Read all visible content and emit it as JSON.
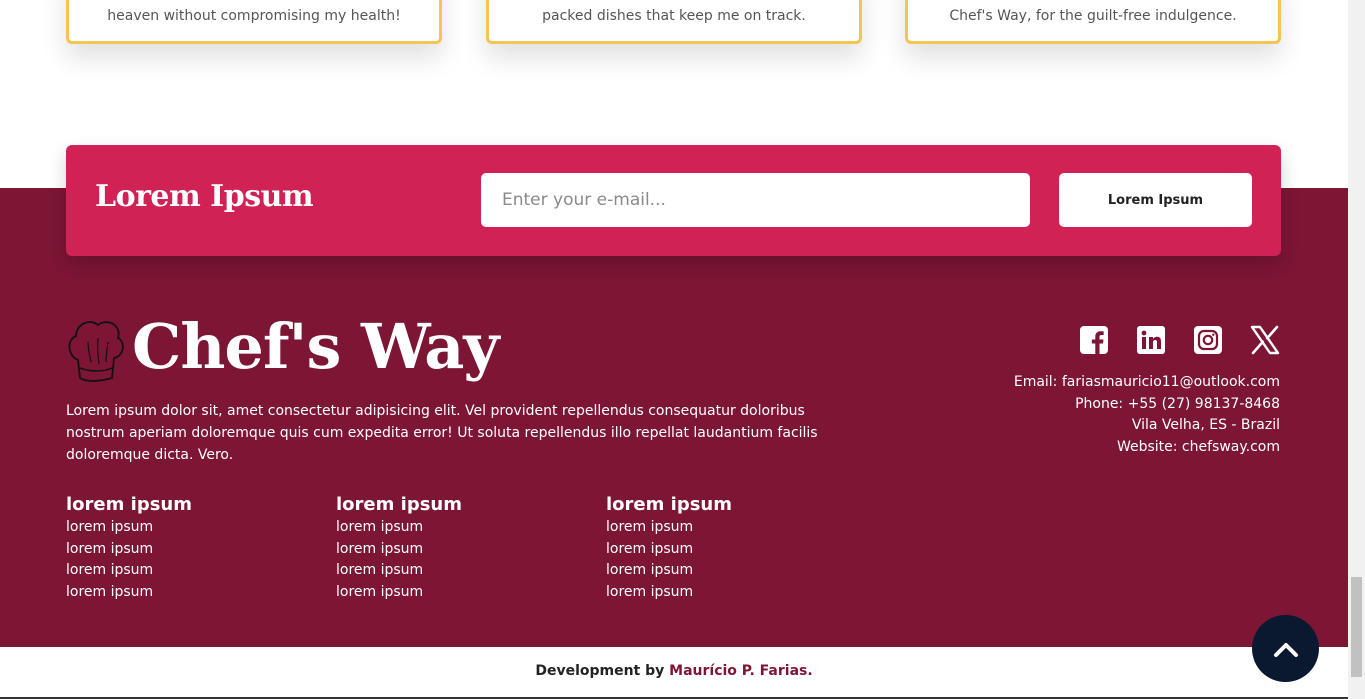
{
  "testimonials": [
    {
      "text_fragment": "heaven without compromising my health!"
    },
    {
      "text_fragment": "packed dishes that keep me on track."
    },
    {
      "text_fragment": "Chef's Way, for the guilt-free indulgence."
    }
  ],
  "newsletter": {
    "title": "Lorem Ipsum",
    "email_placeholder": "Enter your e-mail...",
    "button_label": "Lorem Ipsum"
  },
  "brand": {
    "name": "Chef's Way",
    "logo_icon": "chef-hat-icon",
    "description": "Lorem ipsum dolor sit, amet consectetur adipisicing elit. Vel provident repellendus consequatur doloribus nostrum aperiam doloremque quis cum expedita error! Ut soluta repellendus illo repellat laudantium facilis doloremque dicta. Vero."
  },
  "link_columns": [
    {
      "heading": "lorem ipsum",
      "links": [
        "lorem ipsum",
        "lorem ipsum",
        "lorem ipsum",
        "lorem ipsum"
      ]
    },
    {
      "heading": "lorem ipsum",
      "links": [
        "lorem ipsum",
        "lorem ipsum",
        "lorem ipsum",
        "lorem ipsum"
      ]
    },
    {
      "heading": "lorem ipsum",
      "links": [
        "lorem ipsum",
        "lorem ipsum",
        "lorem ipsum",
        "lorem ipsum"
      ]
    }
  ],
  "social": [
    "facebook-icon",
    "linkedin-icon",
    "instagram-icon",
    "x-icon"
  ],
  "contact": {
    "email": "Email: fariasmauricio11@outlook.com",
    "phone": "Phone: +55 (27) 98137-8468",
    "location": "Vila Velha, ES - Brazil",
    "website": "Website: chefsway.com"
  },
  "credits": {
    "prefix": "Development by ",
    "author": "Maurício P. Farias."
  },
  "colors": {
    "footer_bg": "#7d1535",
    "newsletter_bg": "#d12256",
    "card_border": "#f6c453",
    "back_to_top_bg": "#0a1830"
  },
  "back_to_top_icon": "chevron-up-icon"
}
